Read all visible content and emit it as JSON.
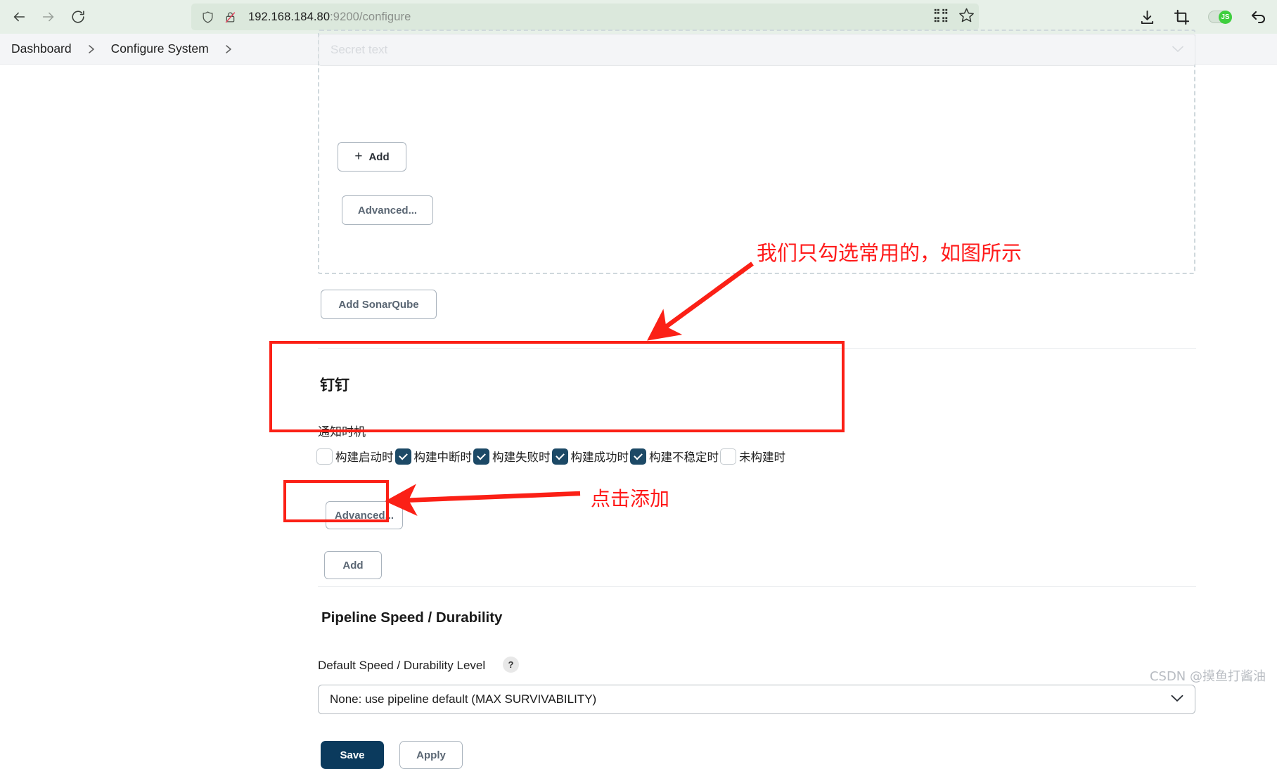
{
  "browser": {
    "back_label": "Back",
    "forward_label": "Forward",
    "reload_label": "Reload",
    "url_host": "192.168.184.80",
    "url_rest": ":9200/configure",
    "url_full": "192.168.184.80:9200/configure",
    "icons": {
      "shield": "shield-icon",
      "insecure_lock": "lock-slash-icon",
      "qrcode": "qr-code-icon",
      "bookmark": "star-icon",
      "downloads": "download-icon",
      "screenshot": "crop-icon",
      "js_toggle": "js-toggle",
      "js_toggle_label": "JS",
      "undo": "undo-arrow-icon"
    }
  },
  "breadcrumb": {
    "items": [
      {
        "label": "Dashboard"
      },
      {
        "label": "Configure System"
      }
    ],
    "separator": "›"
  },
  "page": {
    "secret_field": {
      "placeholder": "Secret text"
    },
    "add_button": {
      "plus": "+",
      "label": "Add"
    },
    "advanced_button_1": {
      "label": "Advanced..."
    },
    "add_sonarqube_button": {
      "label": "Add SonarQube"
    },
    "dingding": {
      "title": "钉钉",
      "notify_label": "通知时机",
      "checkboxes": [
        {
          "label": "构建启动时",
          "checked": false
        },
        {
          "label": "构建中断时",
          "checked": true
        },
        {
          "label": "构建失败时",
          "checked": true
        },
        {
          "label": "构建成功时",
          "checked": true
        },
        {
          "label": "构建不稳定时",
          "checked": true
        },
        {
          "label": "未构建时",
          "checked": false
        }
      ],
      "advanced_button": {
        "label": "Advanced..."
      },
      "add_button": {
        "label": "Add"
      }
    },
    "pipeline": {
      "title": "Pipeline Speed / Durability",
      "field_label": "Default Speed / Durability Level",
      "help_glyph": "?",
      "select_value": "None: use pipeline default (MAX SURVIVABILITY)",
      "select_chevron": "∨"
    },
    "footer": {
      "save_label": "Save",
      "apply_label": "Apply"
    }
  },
  "annotations": {
    "note_1": "我们只勾选常用的，如图所示",
    "note_2": "点击添加",
    "highlight_color": "#fb2016"
  },
  "watermark": {
    "text": "CSDN @摸鱼打酱油"
  }
}
